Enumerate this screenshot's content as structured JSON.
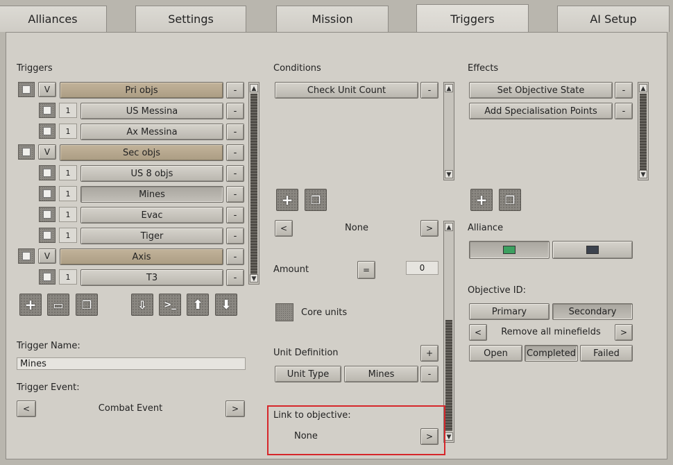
{
  "tabs": [
    {
      "label": "Alliances",
      "active": false
    },
    {
      "label": "Settings",
      "active": false
    },
    {
      "label": "Mission",
      "active": false
    },
    {
      "label": "Triggers",
      "active": true
    },
    {
      "label": "AI Setup",
      "active": false
    }
  ],
  "triggers": {
    "heading": "Triggers",
    "rows": [
      {
        "type": "group",
        "badge": "V",
        "label": "Pri objs"
      },
      {
        "type": "item",
        "badge": "1",
        "label": "US Messina"
      },
      {
        "type": "item",
        "badge": "1",
        "label": "Ax Messina"
      },
      {
        "type": "group",
        "badge": "V",
        "label": "Sec objs"
      },
      {
        "type": "item",
        "badge": "1",
        "label": "US 8 objs"
      },
      {
        "type": "item",
        "badge": "1",
        "label": "Mines",
        "selected": true
      },
      {
        "type": "item",
        "badge": "1",
        "label": "Evac"
      },
      {
        "type": "item",
        "badge": "1",
        "label": "Tiger"
      },
      {
        "type": "group",
        "badge": "V",
        "label": "Axis"
      },
      {
        "type": "item",
        "badge": "1",
        "label": "T3"
      }
    ],
    "remove_label": "-",
    "toolbar_icons": [
      "add-icon",
      "folder-icon",
      "copy-icon",
      "import-icon",
      "console-icon",
      "move-up-icon",
      "move-down-icon"
    ],
    "name_label": "Trigger Name:",
    "name_value": "Mines",
    "event_label": "Trigger Event:",
    "event_value": "Combat Event",
    "prev": "<",
    "next": ">"
  },
  "conditions": {
    "heading": "Conditions",
    "items": [
      "Check Unit Count"
    ],
    "remove_label": "-",
    "selector_value": "None",
    "prev": "<",
    "next": ">",
    "amount_label": "Amount",
    "amount_op": "=",
    "amount_value": "0",
    "core_units_label": "Core units",
    "unit_def_label": "Unit Definition",
    "unit_def_add": "+",
    "unit_type_label": "Unit Type",
    "unit_type_value": "Mines",
    "link_label": "Link to objective:",
    "link_value": "None"
  },
  "effects": {
    "heading": "Effects",
    "items": [
      "Set Objective State",
      "Add Specialisation Points"
    ],
    "remove_label": "-",
    "alliance_label": "Alliance",
    "alliance_colors": [
      "#3ca060",
      "#3c424d"
    ],
    "objective_id_label": "Objective ID:",
    "objective_options": [
      "Primary",
      "Secondary"
    ],
    "objective_selected": "Secondary",
    "effect_value": "Remove all minefields",
    "prev": "<",
    "next": ">",
    "states": [
      "Open",
      "Completed",
      "Failed"
    ],
    "state_selected": "Completed"
  },
  "colors": {
    "highlight_box": "#d6262a",
    "group_row": "#b8a98f"
  }
}
